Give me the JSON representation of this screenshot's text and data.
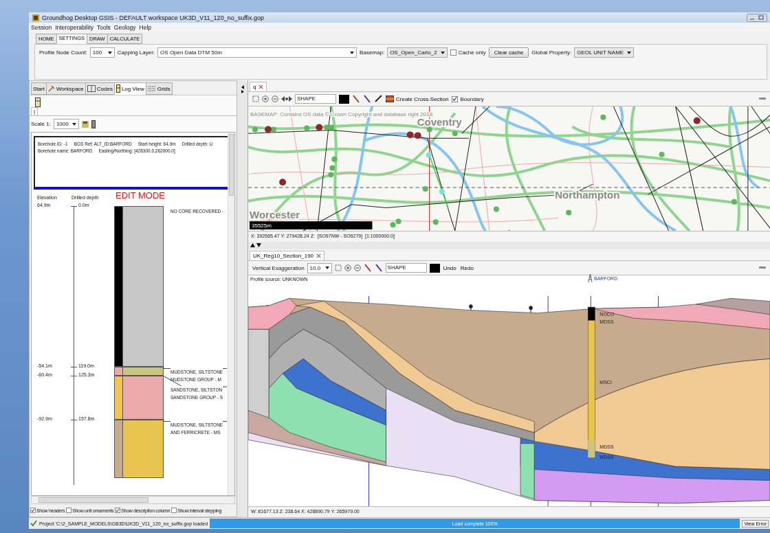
{
  "window": {
    "title": "Groundhog Desktop GSIS - DEFAULT workspace UK3D_V11_120_no_suffix.gop"
  },
  "menu": [
    "Session",
    "Interoperability",
    "Tools",
    "Geology",
    "Help"
  ],
  "ribbon_tabs": [
    {
      "label": "HOME",
      "selected": false
    },
    {
      "label": "SETTINGS",
      "selected": true
    },
    {
      "label": "DRAW",
      "selected": false
    },
    {
      "label": "CALCULATE",
      "selected": false
    }
  ],
  "settings": {
    "profile_node_count": {
      "label": "Profile Node Count:",
      "value": "100"
    },
    "capping_layer": {
      "label": "Capping Layer:",
      "value": "OS Open Data DTM 50m"
    },
    "basemap": {
      "label": "Basemap:",
      "value": "OS_Open_Carto_2"
    },
    "cache_only": {
      "label": "Cache only",
      "checked": false
    },
    "clear_cache": "Clear cache",
    "global_property": {
      "label": "Global Property:",
      "value": "GEOL UNIT NAME"
    }
  },
  "left_panel": {
    "tabs": [
      {
        "label": "Start",
        "kind": "plain",
        "selected": false
      },
      {
        "label": "Workspace",
        "kind": "hammer",
        "selected": false
      },
      {
        "label": "Codes",
        "kind": "book",
        "selected": false
      },
      {
        "label": "Log View",
        "kind": "log",
        "selected": true
      },
      {
        "label": "Grids",
        "kind": "grid",
        "selected": false
      }
    ],
    "sub_tab": "|",
    "scale": {
      "label": "Scale 1:",
      "value": "1000"
    },
    "header": [
      [
        "Borehole ID: -1",
        "BGS Ref: ALT_ID:BARFORD",
        "Start height: 64.9m",
        "Drilled depth: U"
      ],
      [
        "Borehole name: BARFORD",
        "Easting/Northing: [428300.0,262000.0]"
      ]
    ],
    "log": {
      "elevation_heading": "Elevation",
      "depth_heading": "Drilled depth",
      "mode": "EDIT MODE",
      "markers": [
        {
          "elevation": "64.9m",
          "depth": "0.0m"
        },
        {
          "elevation": "-54.1m",
          "depth": "119.0m"
        },
        {
          "elevation": "-60.4m",
          "depth": "125.3m"
        },
        {
          "elevation": "-92.9m",
          "depth": "157.8m"
        }
      ],
      "units": [
        {
          "color": "#c8c8c8",
          "code": {
            "color": "#000000"
          },
          "description": [
            "NO CORE RECOVERED -"
          ]
        },
        {
          "color": "#c9c77c",
          "code": {
            "color": "#f2a7a7"
          },
          "description": [
            "MUDSTONE, SILTSTONE",
            "MUDSTONE GROUP - M"
          ]
        },
        {
          "color": "#edaaaa",
          "code": {
            "color": "#f6c34e"
          },
          "description": [
            "SANDSTONE, SILTSTON",
            "SANDSTONE GROUP - S"
          ]
        },
        {
          "color": "#e8c54e",
          "code": {
            "color": "#c7ab8c"
          },
          "description": [
            "MUDSTONE, SILTSTONE",
            "AND FERRICRETE - MS"
          ]
        }
      ]
    },
    "options": [
      {
        "label": "Show headers",
        "checked": true
      },
      {
        "label": "Show unit ornaments",
        "checked": false
      },
      {
        "label": "Show description column",
        "checked": true
      },
      {
        "label": "Show interval stepping",
        "checked": false
      }
    ]
  },
  "map_view": {
    "tab": "q",
    "shape_field": "SHAPE",
    "create_cross_section": "Create Cross-Section",
    "boundary": {
      "label": "Boundary",
      "checked": true
    },
    "attribution": "BASEMAP: Contains OS data © Crown Copyright and database right 2018",
    "places": [
      "Coventry",
      "Northampton",
      "Worcester"
    ],
    "scale_bar": "35525m",
    "coordinates": "X: 392665.47 Y: 279428.24 Z:  [SO97NW - SO9279]  [1:1000000.0]"
  },
  "section_view": {
    "tab": "UK_Reg10_Section_190",
    "exaggeration": {
      "label": "Vertical Exaggeration",
      "value": "10.0"
    },
    "shape_field": "SHAPE",
    "undo": "Undo",
    "redo": "Redo",
    "profile_source": "Profile source: UNKNOWN",
    "borehole": "BARFORD",
    "unit_labels": [
      "NOCO",
      "MDSS",
      "MSCI",
      "MDSS",
      "MDSS"
    ],
    "coordinates": "W: 81677.13 Z: 238.64 X: 428890.79 Y: 265979.00"
  },
  "status_bar": {
    "message": "Project 'C:\\2_SAMPLE_MODELS\\GB3D\\UK3D_V11_120_no_suffix.gop loaded",
    "progress": {
      "label": "Load complete 100%",
      "level": 1
    },
    "view_error": "View Error"
  }
}
